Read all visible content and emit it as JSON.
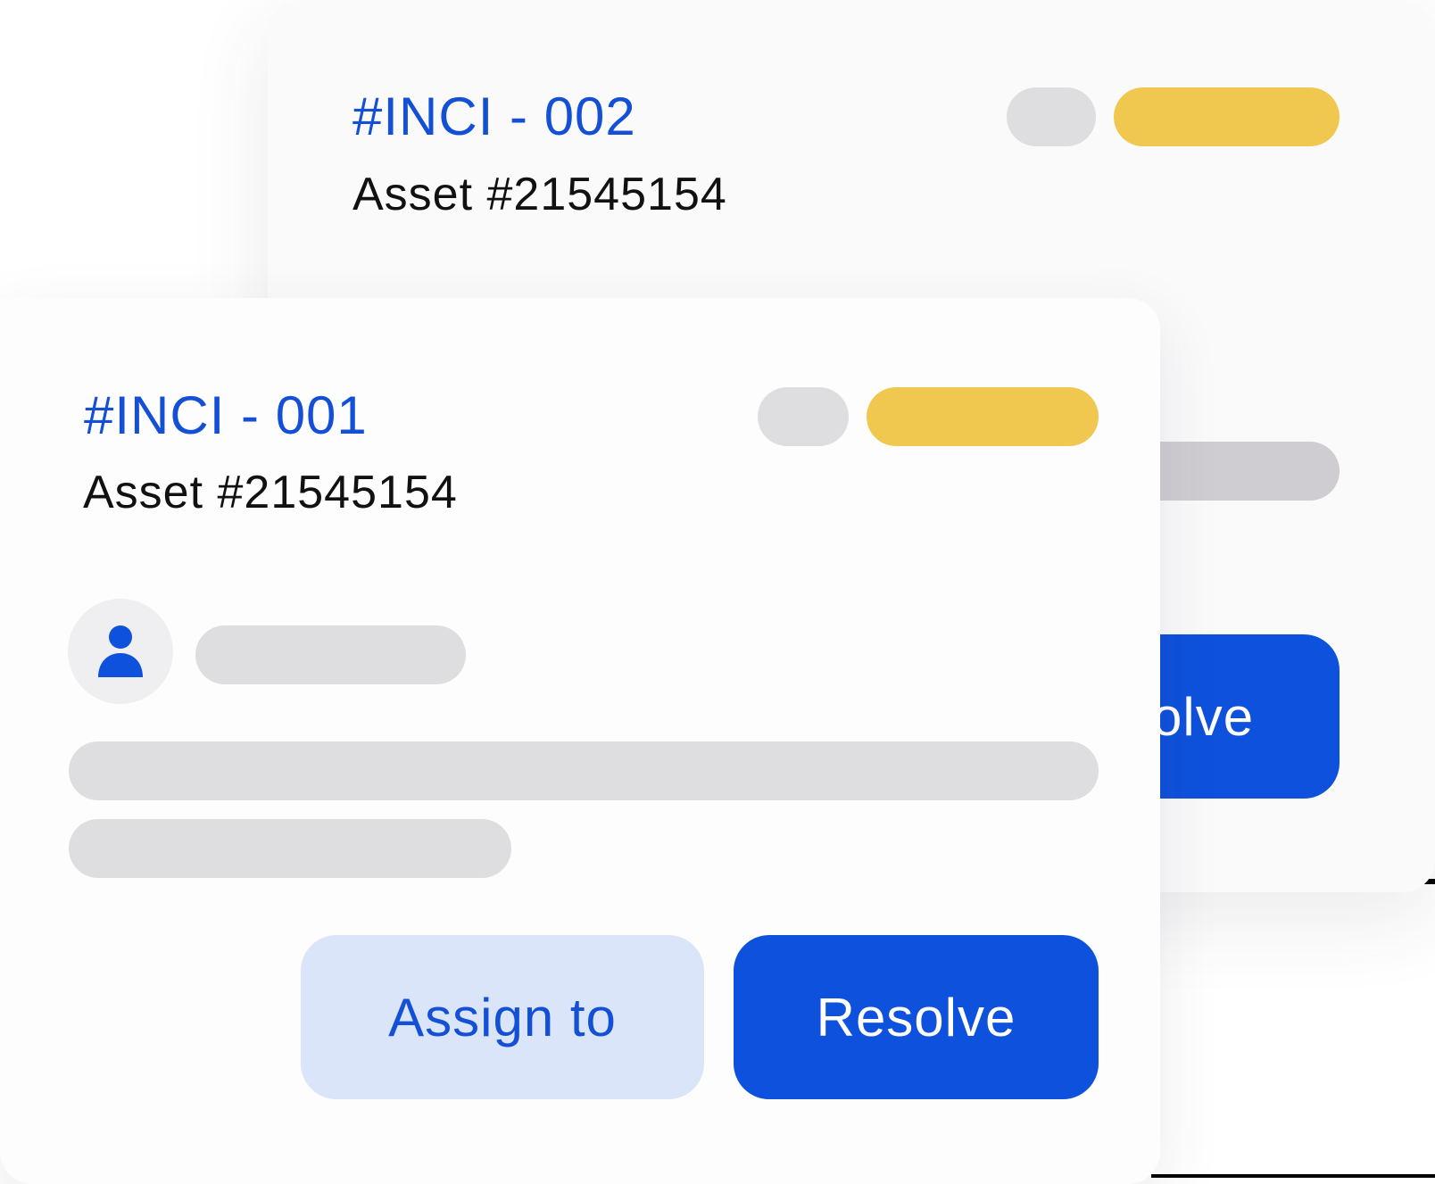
{
  "incident_back": {
    "id": "#INCI - 002",
    "asset": "Asset #21545154",
    "resolve_label": "solve"
  },
  "incident_front": {
    "id": "#INCI - 001",
    "asset": "Asset #21545154",
    "assign_label": "Assign to",
    "resolve_label": "Resolve"
  },
  "colors": {
    "accent_blue": "#0e51dc",
    "link_blue": "#1450d6",
    "badge_yellow": "#f1c84f",
    "placeholder_grey": "#dedde0",
    "assign_bg": "#dbe5f9"
  },
  "icons": {
    "avatar": "user-icon"
  }
}
